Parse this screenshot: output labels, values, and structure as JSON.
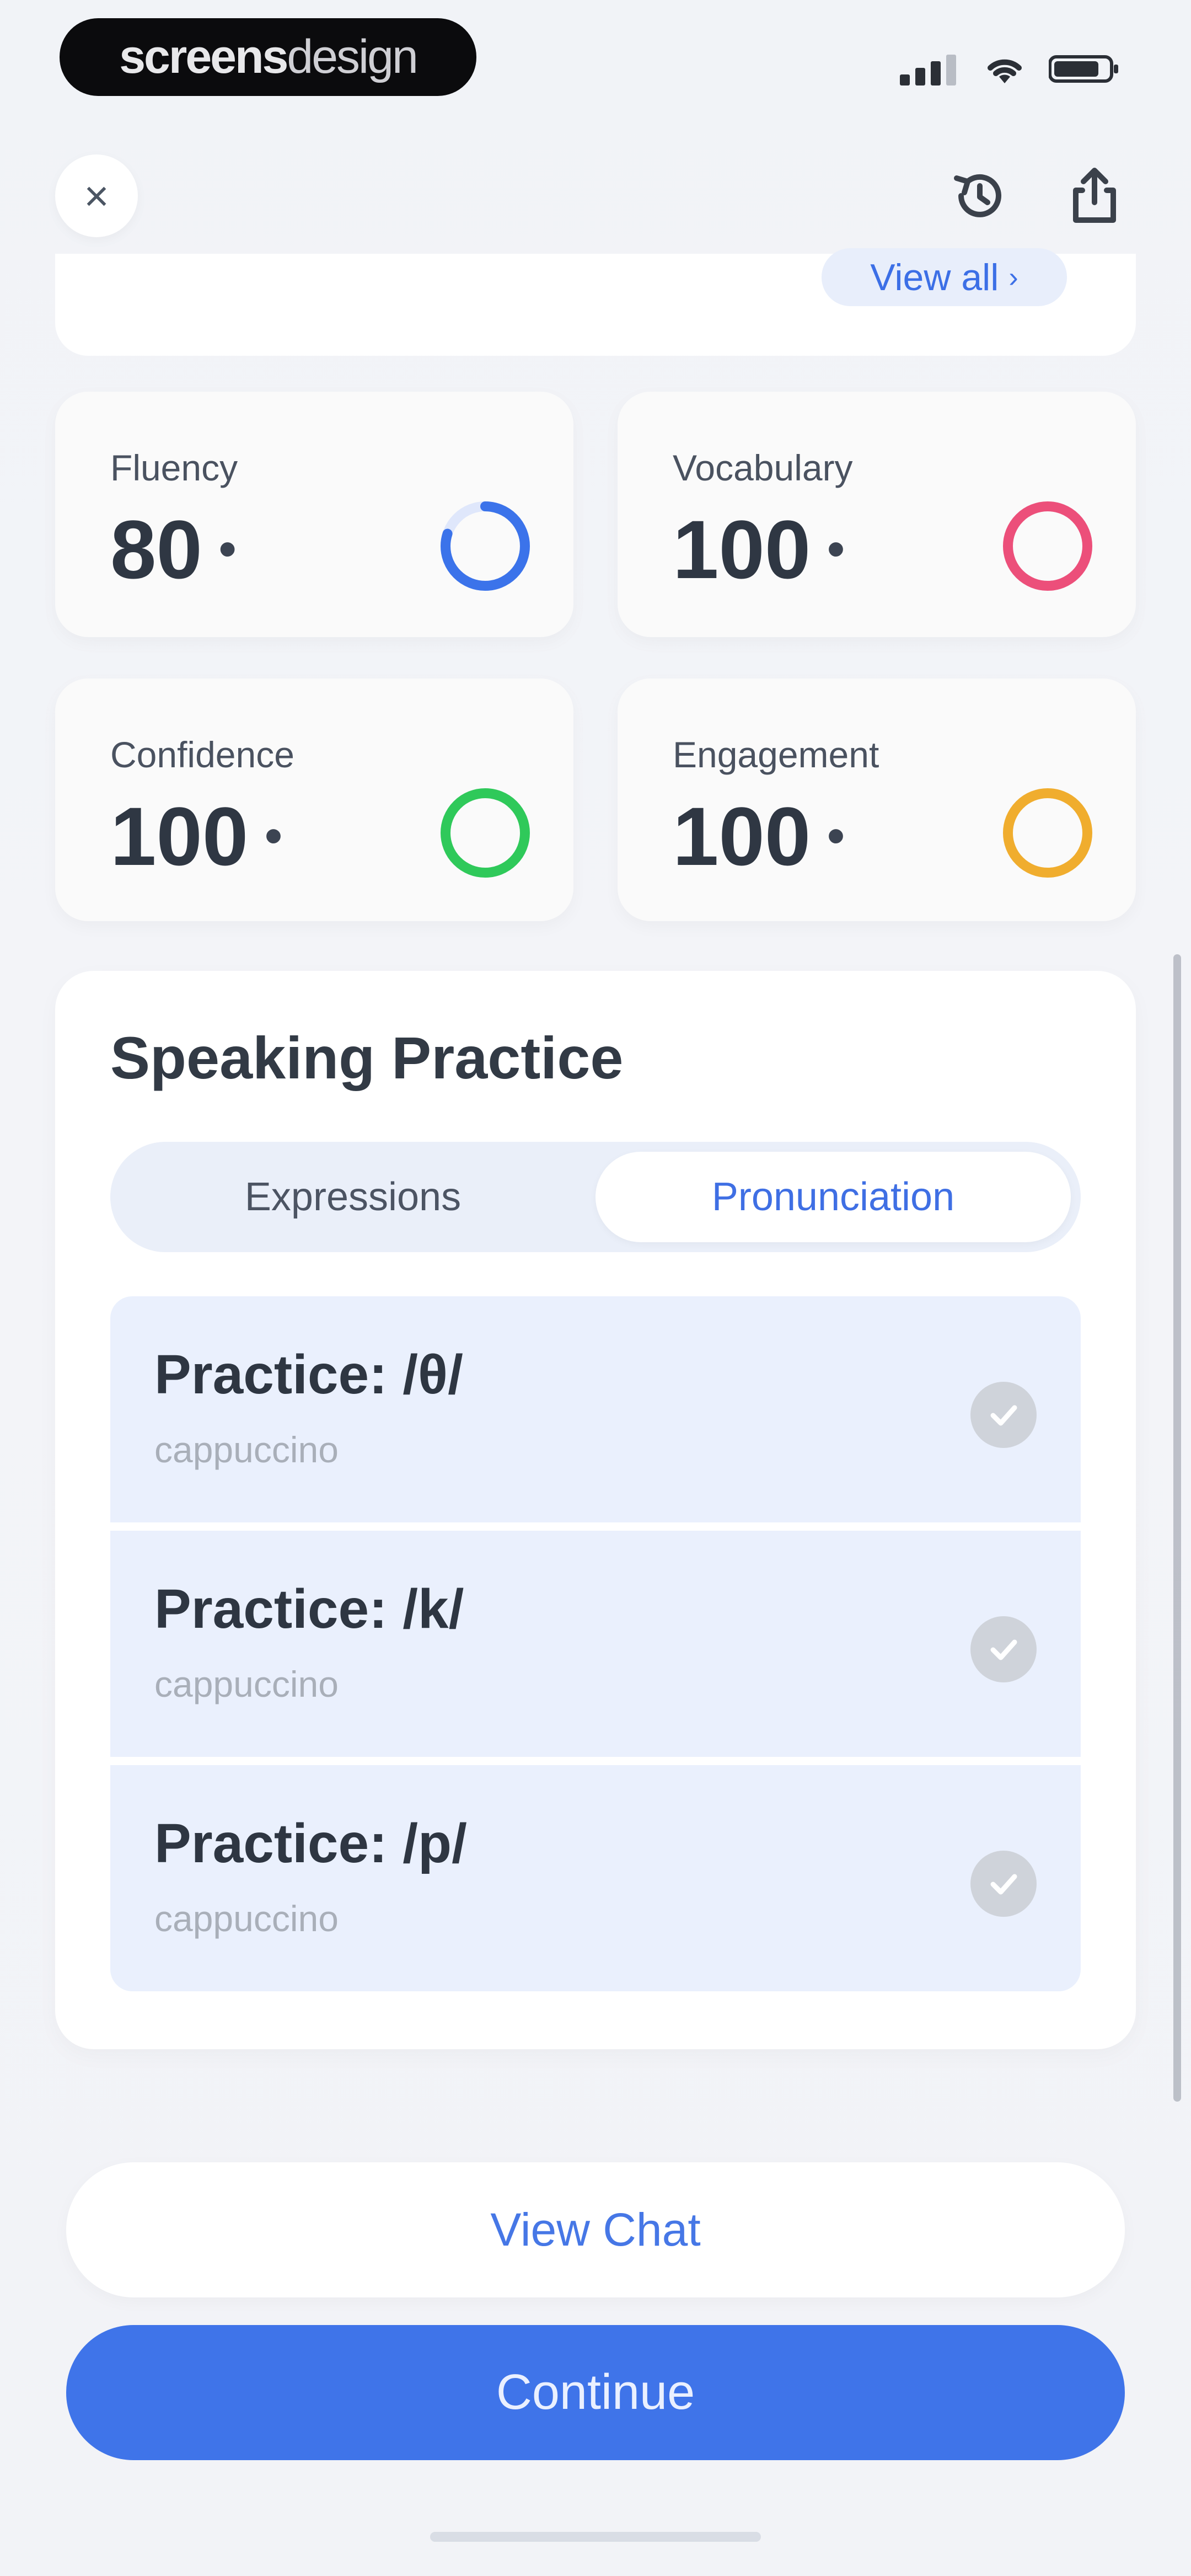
{
  "status_bar": {
    "watermark_part1": "screens",
    "watermark_part2": "design"
  },
  "nav": {
    "close_glyph": "×",
    "icons": [
      "close-icon",
      "history-icon",
      "share-icon"
    ]
  },
  "summary": {
    "view_all_label": "View all",
    "view_all_chevron": "›"
  },
  "metrics": [
    {
      "label": "Fluency",
      "value": "80",
      "ring_color": "#3b73ea",
      "progress": 0.8
    },
    {
      "label": "Vocabulary",
      "value": "100",
      "ring_color": "#ec4f7a",
      "progress": 1.0
    },
    {
      "label": "Confidence",
      "value": "100",
      "ring_color": "#2fc95a",
      "progress": 1.0
    },
    {
      "label": "Engagement",
      "value": "100",
      "ring_color": "#f0ad2e",
      "progress": 1.0
    }
  ],
  "speaking_practice": {
    "title": "Speaking Practice",
    "tabs": [
      "Expressions",
      "Pronunciation"
    ],
    "selected_tab": "Pronunciation",
    "items": [
      {
        "title": "Practice:  /θ/",
        "subtitle": "cappuccino"
      },
      {
        "title": "Practice:  /k/",
        "subtitle": "cappuccino"
      },
      {
        "title": "Practice:  /p/",
        "subtitle": "cappuccino"
      }
    ]
  },
  "actions": {
    "view_chat": "View Chat",
    "continue": "Continue"
  },
  "colors": {
    "accent": "#3f74e9",
    "card_bg": "#ffffff",
    "item_bg": "#eaf0fd"
  }
}
